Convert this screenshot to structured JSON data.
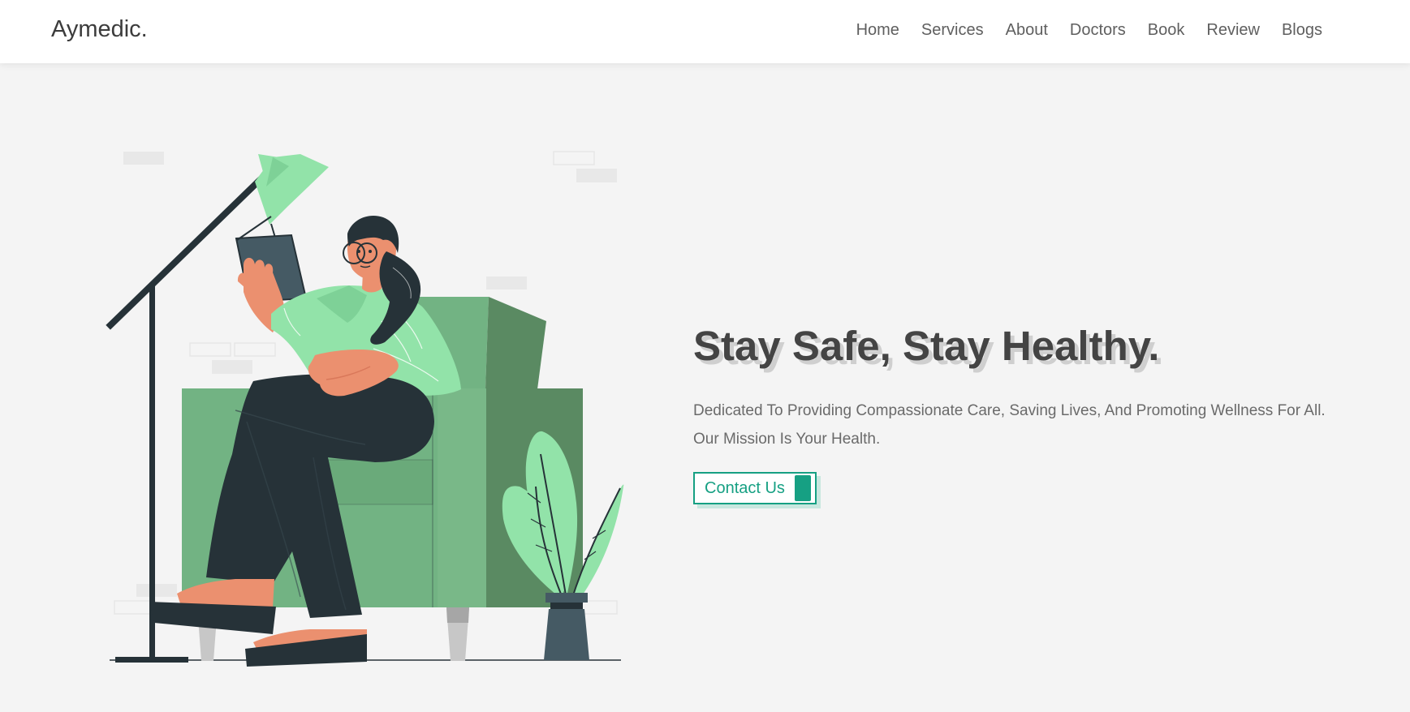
{
  "header": {
    "logo": "Aymedic.",
    "nav": [
      {
        "label": "Home"
      },
      {
        "label": "Services"
      },
      {
        "label": "About"
      },
      {
        "label": "Doctors"
      },
      {
        "label": "Book"
      },
      {
        "label": "Review"
      },
      {
        "label": "Blogs"
      }
    ]
  },
  "hero": {
    "title": "Stay Safe, Stay Healthy.",
    "description": "Dedicated To Providing Compassionate Care, Saving Lives, And Promoting Wellness For All. Our Mission Is Your Health.",
    "button_label": "Contact Us",
    "illustration": "woman-reading-in-armchair-illustration"
  },
  "colors": {
    "accent": "#16a083",
    "background": "#f4f4f4",
    "heading": "#444444",
    "text": "#6a6a6a",
    "sofa": "#72b383",
    "leaf": "#92e3a9",
    "dark": "#263238"
  }
}
